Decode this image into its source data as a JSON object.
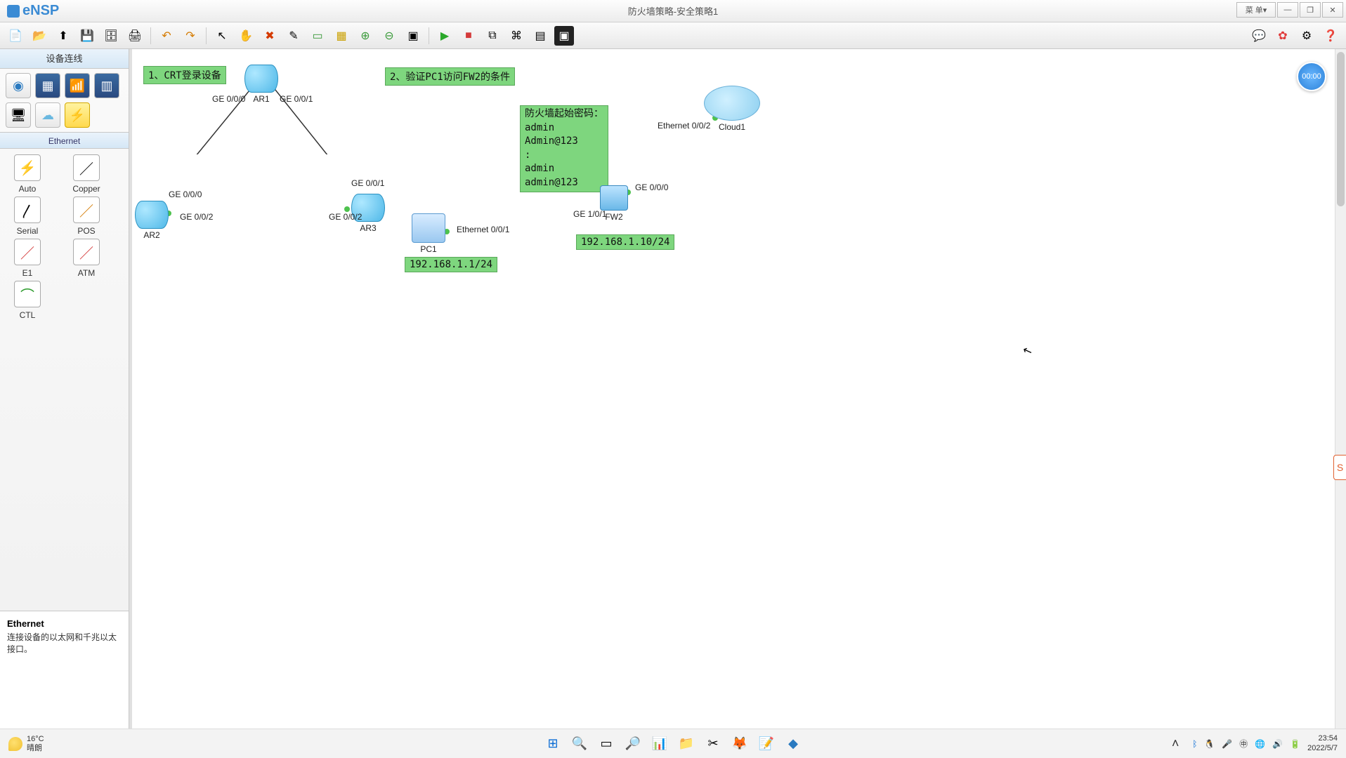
{
  "app": {
    "name": "eNSP",
    "title": "防火墙策略-安全策略1"
  },
  "window_controls": {
    "menu": "菜  单▾",
    "min": "—",
    "max": "❐",
    "close": "✕"
  },
  "toolbar": {
    "left": [
      "new-topo",
      "open-topo",
      "import",
      "save",
      "save-as",
      "print",
      "undo",
      "redo",
      "select",
      "pan",
      "delete",
      "edit",
      "note",
      "palette",
      "zoom-in",
      "zoom-out",
      "fit",
      "start",
      "stop",
      "capture",
      "cli",
      "grid",
      "screenshot"
    ],
    "right": [
      "feedback",
      "huawei",
      "settings",
      "help"
    ]
  },
  "sidebar": {
    "header": "设备连线",
    "categories": [
      "router",
      "switch",
      "wlan",
      "firewall",
      "pc",
      "cloud",
      "link"
    ],
    "selected_category": "link",
    "sub_header": "Ethernet",
    "items": [
      {
        "key": "auto",
        "label": "Auto",
        "glyph": "⚡"
      },
      {
        "key": "copper",
        "label": "Copper",
        "glyph": "／"
      },
      {
        "key": "serial",
        "label": "Serial",
        "glyph": "〳"
      },
      {
        "key": "pos",
        "label": "POS",
        "glyph": "／"
      },
      {
        "key": "e1",
        "label": "E1",
        "glyph": "／"
      },
      {
        "key": "atm",
        "label": "ATM",
        "glyph": "／"
      },
      {
        "key": "ctl",
        "label": "CTL",
        "glyph": "⌒"
      }
    ],
    "desc": {
      "title": "Ethernet",
      "text": "连接设备的以太网和千兆以太接口。"
    }
  },
  "canvas": {
    "clock": "00:00",
    "notes": {
      "n1": "1、CRT登录设备",
      "n2": "2、验证PC1访问FW2的条件",
      "n3": "防火墙起始密码：\nadmin\nAdmin@123\n:\nadmin\nadmin@123",
      "ip_pc1": "192.168.1.1/24",
      "ip_fw2": "192.168.1.10/24"
    },
    "devices": {
      "ar1": "AR1",
      "ar2": "AR2",
      "ar3": "AR3",
      "pc1": "PC1",
      "fw2": "FW2",
      "cloud1": "Cloud1"
    },
    "ports": {
      "ar1_l": "GE 0/0/0",
      "ar1_r": "GE 0/0/1",
      "ar2_t": "GE 0/0/0",
      "ar2_r": "GE 0/0/2",
      "ar3_t": "GE 0/0/1",
      "ar3_l": "GE 0/0/2",
      "pc1_r": "Ethernet 0/0/1",
      "fw2_l": "GE 1/0/1",
      "fw2_r": "GE 0/0/0",
      "cloud_l": "Ethernet 0/0/2"
    }
  },
  "taskbar": {
    "weather": {
      "temp": "16°C",
      "cond": "晴朗"
    },
    "apps": [
      "start",
      "search",
      "taskview",
      "everything",
      "monitor",
      "explorer",
      "snip",
      "firefox",
      "notes",
      "ensp"
    ],
    "tray": [
      "expand",
      "bluetooth",
      "qq",
      "mic",
      "ime",
      "net",
      "volume",
      "battery"
    ],
    "time": "23:54",
    "date": "2022/5/7"
  },
  "float_widget": "S"
}
